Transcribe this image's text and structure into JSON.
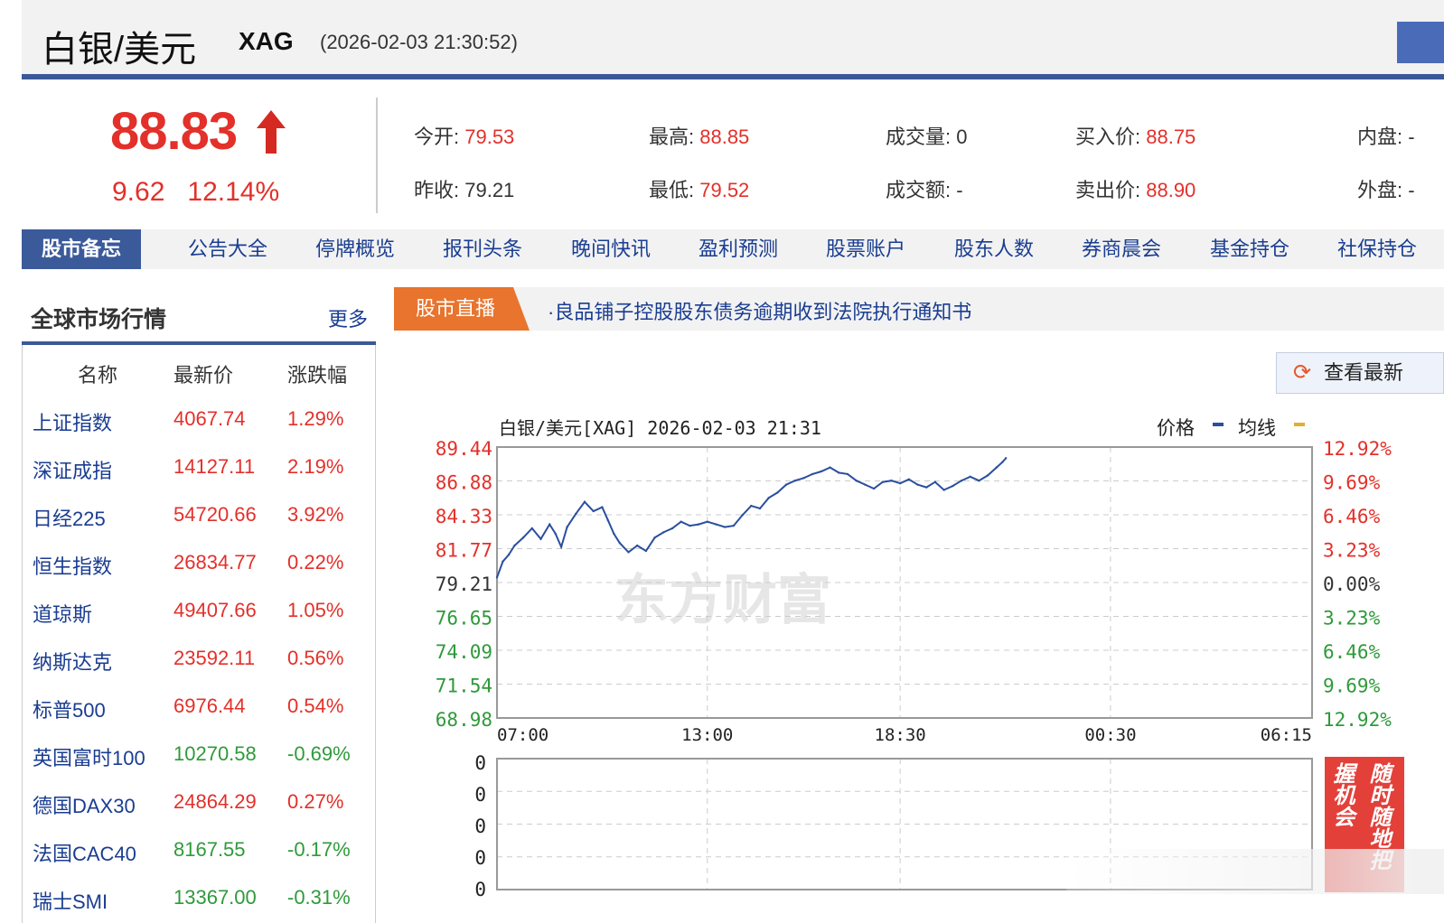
{
  "header": {
    "title": "白银/美元",
    "code": "XAG",
    "time": "(2026-02-03 21:30:52)"
  },
  "quote": {
    "price": "88.83",
    "change": "9.62",
    "change_pct": "12.14%",
    "stats": [
      {
        "label": "今开:",
        "value": "79.53",
        "color": "red"
      },
      {
        "label": "最高:",
        "value": "88.85",
        "color": "red"
      },
      {
        "label": "成交量:",
        "value": "0",
        "color": "plain"
      },
      {
        "label": "买入价:",
        "value": "88.75",
        "color": "red"
      },
      {
        "label": "内盘:",
        "value": "-",
        "color": "plain"
      },
      {
        "label": "昨收:",
        "value": "79.21",
        "color": "plain"
      },
      {
        "label": "最低:",
        "value": "79.52",
        "color": "red"
      },
      {
        "label": "成交额:",
        "value": "-",
        "color": "plain"
      },
      {
        "label": "卖出价:",
        "value": "88.90",
        "color": "red"
      },
      {
        "label": "外盘:",
        "value": "-",
        "color": "plain"
      }
    ]
  },
  "nav": [
    "股市备忘",
    "公告大全",
    "停牌概览",
    "报刊头条",
    "晚间快讯",
    "盈利预测",
    "股票账户",
    "股东人数",
    "券商晨会",
    "基金持仓",
    "社保持仓"
  ],
  "global_market": {
    "title": "全球市场行情",
    "more": "更多",
    "headers": [
      "名称",
      "最新价",
      "涨跌幅"
    ],
    "rows": [
      [
        "上证指数",
        "4067.74",
        "1.29%",
        "red"
      ],
      [
        "深证成指",
        "14127.11",
        "2.19%",
        "red"
      ],
      [
        "日经225",
        "54720.66",
        "3.92%",
        "red"
      ],
      [
        "恒生指数",
        "26834.77",
        "0.22%",
        "red"
      ],
      [
        "道琼斯",
        "49407.66",
        "1.05%",
        "red"
      ],
      [
        "纳斯达克",
        "23592.11",
        "0.56%",
        "red"
      ],
      [
        "标普500",
        "6976.44",
        "0.54%",
        "red"
      ],
      [
        "英国富时100",
        "10270.58",
        "-0.69%",
        "green"
      ],
      [
        "德国DAX30",
        "24864.29",
        "0.27%",
        "red"
      ],
      [
        "法国CAC40",
        "8167.55",
        "-0.17%",
        "green"
      ],
      [
        "瑞士SMI",
        "13367.00",
        "-0.31%",
        "green"
      ]
    ]
  },
  "live": {
    "tag": "股市直播",
    "news": "·良品铺子控股股东债务逾期收到法院执行通知书"
  },
  "refresh_label": "查看最新",
  "ad_text": "随时随地把握机会",
  "colors": {
    "up": "#e3302a",
    "down": "#2e9a3a",
    "link": "#1a3d91",
    "price_line": "#2a4f9e",
    "avg_line": "#e0b030"
  },
  "chart_data": {
    "type": "line",
    "title": "白银/美元[XAG] 2026-02-03 21:31",
    "legend": [
      "价格",
      "均线"
    ],
    "watermark": "东方财富",
    "ylim": [
      68.98,
      89.44
    ],
    "prev_close": 79.21,
    "y_ticks": [
      "89.44",
      "86.88",
      "84.33",
      "81.77",
      "79.21",
      "76.65",
      "74.09",
      "71.54",
      "68.98"
    ],
    "pct_ticks": [
      "12.92%",
      "9.69%",
      "6.46%",
      "3.23%",
      "0.00%",
      "3.23%",
      "6.46%",
      "9.69%",
      "12.92%"
    ],
    "x_ticks": [
      "07:00",
      "13:00",
      "18:30",
      "00:30",
      "06:15"
    ],
    "x_range_minutes": [
      0,
      1395
    ],
    "series_minutes": [
      0,
      10,
      20,
      30,
      45,
      60,
      75,
      90,
      100,
      110,
      120,
      135,
      150,
      165,
      180,
      190,
      200,
      210,
      225,
      240,
      255,
      270,
      285,
      300,
      315,
      330,
      345,
      360,
      375,
      390,
      405,
      420,
      435,
      450,
      465,
      480,
      495,
      510,
      525,
      540,
      555,
      570,
      585,
      600,
      615,
      630,
      645,
      660,
      675,
      690,
      705,
      720,
      735,
      750,
      765,
      780,
      795,
      810,
      825,
      840,
      855,
      865,
      871
    ],
    "series_price": [
      79.6,
      80.8,
      81.3,
      82.0,
      82.6,
      83.3,
      82.5,
      83.6,
      82.9,
      81.9,
      83.4,
      84.4,
      85.3,
      84.6,
      84.9,
      83.9,
      82.9,
      82.2,
      81.5,
      82.0,
      81.6,
      82.6,
      83.0,
      83.3,
      83.8,
      83.5,
      83.6,
      83.8,
      83.6,
      83.4,
      83.5,
      84.3,
      85.0,
      84.8,
      85.6,
      86.0,
      86.6,
      86.9,
      87.1,
      87.4,
      87.6,
      87.9,
      87.5,
      87.4,
      86.9,
      86.6,
      86.3,
      86.8,
      86.9,
      86.7,
      87.0,
      86.6,
      86.4,
      86.8,
      86.2,
      86.5,
      86.9,
      87.2,
      86.9,
      87.3,
      87.9,
      88.3,
      88.6
    ],
    "volume_ticks": [
      "0",
      "0",
      "0",
      "0",
      "0"
    ]
  }
}
